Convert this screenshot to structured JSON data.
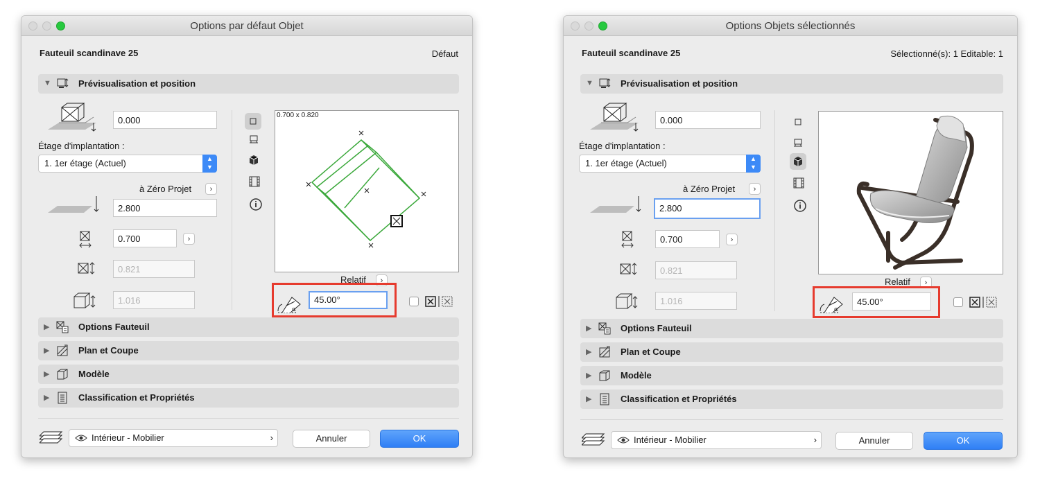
{
  "dialogs": [
    {
      "title": "Options par défaut Objet",
      "object_name": "Fauteuil scandinave 25",
      "status": "Défaut",
      "preview_section": "Prévisualisation et position",
      "elevation": "0.000",
      "story_label": "Étage d'implantation :",
      "story_value": "1. 1er étage (Actuel)",
      "reference_label": "à Zéro Projet",
      "height": "2.800",
      "width": "0.700",
      "depth": "0.821",
      "dim3": "1.016",
      "preview_caption": "0.700 x 0.820",
      "relative_label": "Relatif",
      "angle": "45.00°",
      "sections": [
        "Options Fauteuil",
        "Plan et Coupe",
        "Modèle",
        "Classification et Propriétés"
      ],
      "layer": "Intérieur - Mobilier",
      "cancel": "Annuler",
      "ok": "OK"
    },
    {
      "title": "Options Objets sélectionnés",
      "object_name": "Fauteuil scandinave 25",
      "status": "Sélectionné(s): 1 Editable: 1",
      "preview_section": "Prévisualisation et position",
      "elevation": "0.000",
      "story_label": "Étage d'implantation :",
      "story_value": "1. 1er étage (Actuel)",
      "reference_label": "à Zéro Projet",
      "height": "2.800",
      "width": "0.700",
      "depth": "0.821",
      "dim3": "1.016",
      "relative_label": "Relatif",
      "angle": "45.00°",
      "sections": [
        "Options Fauteuil",
        "Plan et Coupe",
        "Modèle",
        "Classification et Propriétés"
      ],
      "layer": "Intérieur - Mobilier",
      "cancel": "Annuler",
      "ok": "OK"
    }
  ],
  "colors": {
    "accent": "#3d8af7",
    "highlight": "#e63b2e",
    "plan_lines": "#3aa83a"
  }
}
